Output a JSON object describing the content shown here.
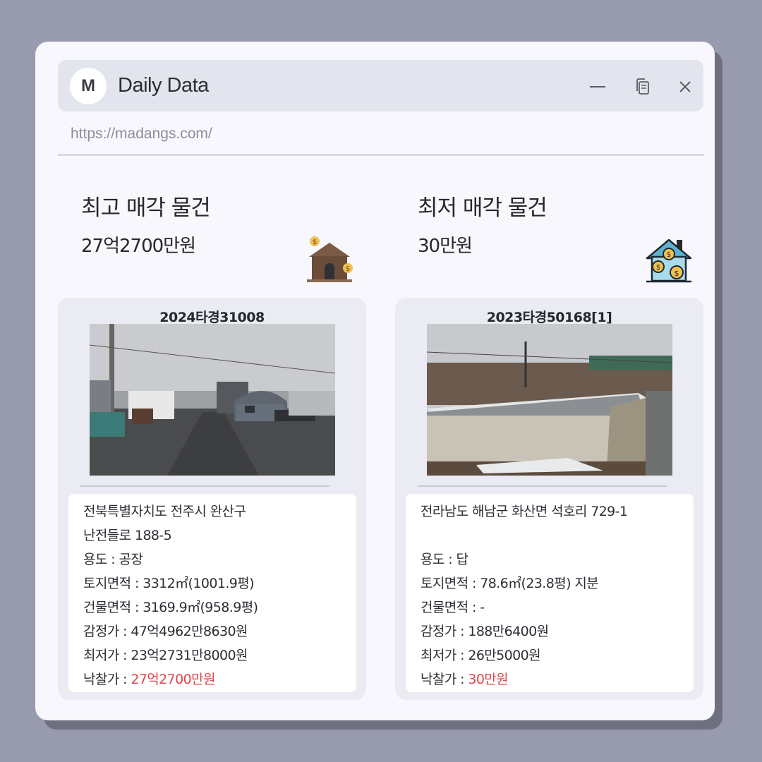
{
  "app": {
    "logo_letter": "M",
    "title": "Daily Data",
    "url": "https://madangs.com/"
  },
  "icons": {
    "minimize": "minimize-icon",
    "copy": "copy-icon",
    "close": "close-icon",
    "left_house": "house-with-coins-icon",
    "right_house": "house-money-icon"
  },
  "colors": {
    "accent_price": "#e0454d",
    "background": "#989bae",
    "panel": "#f7f7fd"
  },
  "highest": {
    "heading": "최고 매각 물건",
    "price": "27억2700만원",
    "case_no": "2024타경31008",
    "address1": "전북특별자치도 전주시 완산구",
    "address2": "난전들로 188-5",
    "usage_label": "용도 : ",
    "usage": "공장",
    "land_label": "토지면적 : ",
    "land": "3312㎡(1001.9평)",
    "building_label": "건물면적 :  ",
    "building": "3169.9㎡(958.9평)",
    "appraisal_label": "감정가 : ",
    "appraisal": "47억4962만8630원",
    "minimum_label": "최저가 : ",
    "minimum": "23억2731만8000원",
    "winning_label": "낙찰가 : ",
    "winning": "27억2700만원"
  },
  "lowest": {
    "heading": "최저 매각 물건",
    "price": "30만원",
    "case_no": "2023타경50168[1]",
    "address1": "전라남도 해남군 화산면 석호리 729-1",
    "usage_label": "용도 :  ",
    "usage": "답",
    "land_label": "토지면적 : ",
    "land": "78.6㎡(23.8평) 지분",
    "building_label": "건물면적 : ",
    "building": "-",
    "appraisal_label": "감정가 : ",
    "appraisal": "188만6400원",
    "minimum_label": "최저가 : ",
    "minimum": "26만5000원",
    "winning_label": "낙찰가 : ",
    "winning": "30만원"
  }
}
